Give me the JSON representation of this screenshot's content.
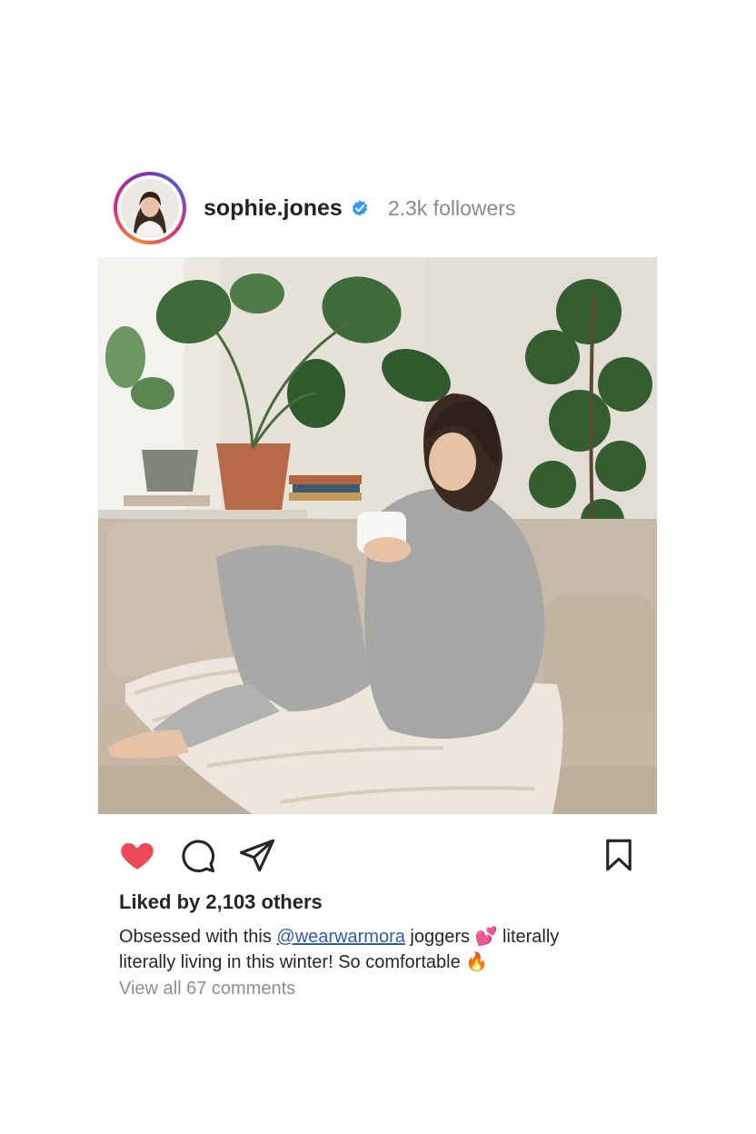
{
  "post": {
    "username": "sophie.jones",
    "followers": "2.3k followers",
    "likes_text": "Liked by 2,103 others",
    "caption": {
      "prefix": "Obsessed with this ",
      "mention": "@wearwarmora",
      "middle": " joggers ",
      "emoji_heart": "💕",
      "after_heart": " literally",
      "line2": "literally living in this winter! So comfortable ",
      "emoji_fire": "🔥"
    },
    "view_comments": "View all 67 comments",
    "liked": true,
    "colors": {
      "heart": "#ed4956",
      "verified": "#3897f0",
      "mention": "#2d5ea8",
      "muted": "#8e8e8e"
    },
    "icons": [
      "heart-icon",
      "comment-icon",
      "share-icon",
      "bookmark-icon",
      "verified-badge-icon"
    ]
  }
}
